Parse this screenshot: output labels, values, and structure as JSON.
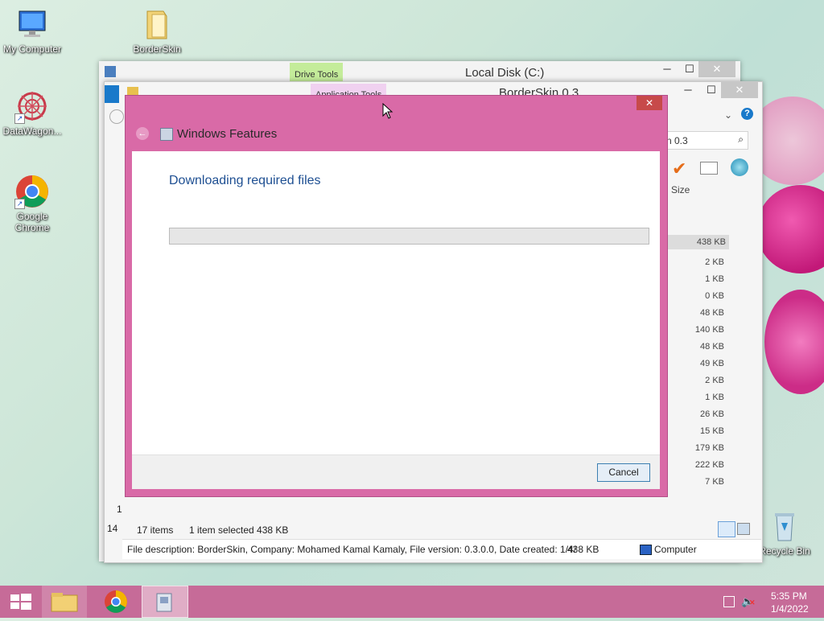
{
  "desktop": {
    "icons": [
      {
        "label": "My Computer",
        "icon": "computer-icon"
      },
      {
        "label": "BorderSkin",
        "icon": "folder-icon"
      },
      {
        "label": "DataWagon...",
        "icon": "datawagon-icon"
      },
      {
        "label": "Google Chrome",
        "icon": "chrome-icon"
      },
      {
        "label": "Recycle Bin",
        "icon": "recycle-bin-icon"
      }
    ]
  },
  "explorer_back": {
    "title": "Local Disk (C:)",
    "context_tab": "Drive Tools",
    "controls": {
      "minimize": "─",
      "maximize": "☐",
      "close": "✕"
    }
  },
  "explorer_front": {
    "title": "BorderSkin 0.3",
    "context_tab": "Application Tools",
    "search_value": "n 0.3",
    "column_size": "Size",
    "sizes": [
      "438 KB",
      "2 KB",
      "1 KB",
      "0 KB",
      "48 KB",
      "140 KB",
      "48 KB",
      "49 KB",
      "2 KB",
      "1 KB",
      "26 KB",
      "15 KB",
      "179 KB",
      "222 KB",
      "7 KB"
    ],
    "left_numbers": [
      "1",
      "14"
    ],
    "status_items": "17 items",
    "status_selected": "1 item selected  438 KB",
    "details_bar": "File description: BorderSkin, Company: Mohamed Kamal Kamaly, File version: 0.3.0.0, Date created: 1/4/",
    "details_size": "438 KB",
    "details_location": "Computer",
    "controls": {
      "minimize": "─",
      "maximize": "☐",
      "close": "✕"
    }
  },
  "dialog": {
    "title": "Windows Features",
    "heading": "Downloading required files",
    "progress_fraction": 0.0,
    "cancel_label": "Cancel",
    "close_label": "✕"
  },
  "taskbar": {
    "time": "5:35 PM",
    "date": "1/4/2022"
  },
  "colors": {
    "dialog_frame": "#d96aa7",
    "taskbar": "#c66b98",
    "heading_blue": "#1e4f92"
  }
}
